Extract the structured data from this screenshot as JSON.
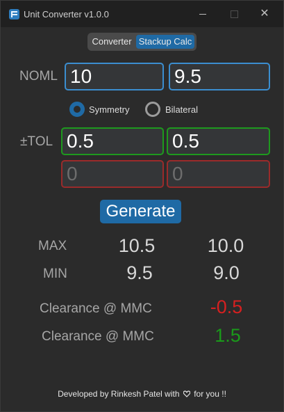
{
  "window": {
    "title": "Unit Converter v1.0.0",
    "minimize": "–",
    "maximize": "",
    "close": "✕"
  },
  "tabs": [
    {
      "label": "Converter",
      "active": false
    },
    {
      "label": "Stackup Calc",
      "active": true
    }
  ],
  "nominal": {
    "label": "NOML",
    "values": [
      "10",
      "9.5"
    ]
  },
  "mode": {
    "options": [
      {
        "label": "Symmetry",
        "selected": true
      },
      {
        "label": "Bilateral",
        "selected": false
      }
    ]
  },
  "tolerance": {
    "label": "±TOL",
    "upper": [
      "0.5",
      "0.5"
    ],
    "lower": [
      "0",
      "0"
    ]
  },
  "generate_label": "Generate",
  "results": {
    "max": {
      "label": "MAX",
      "values": [
        "10.5",
        "10.0"
      ]
    },
    "min": {
      "label": "MIN",
      "values": [
        "9.5",
        "9.0"
      ]
    }
  },
  "clearance": [
    {
      "label": "Clearance @ MMC",
      "value": "-0.5",
      "color": "#d62020"
    },
    {
      "label": "Clearance @ MMC",
      "value": "1.5",
      "color": "#1a9a1a"
    }
  ],
  "footer": {
    "prefix": "Developed by Rinkesh Patel with",
    "suffix": "for you !!",
    "icon": "heart-icon"
  }
}
